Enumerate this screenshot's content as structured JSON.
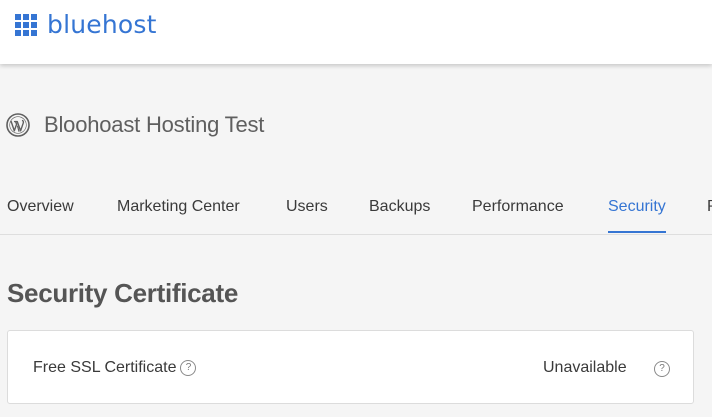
{
  "header": {
    "logo_text": "bluehost",
    "brand_color": "#3575d3"
  },
  "site": {
    "icon": "wordpress-icon",
    "title": "Bloohoast Hosting Test"
  },
  "tabs": [
    {
      "label": "Overview",
      "active": false
    },
    {
      "label": "Marketing Center",
      "active": false
    },
    {
      "label": "Users",
      "active": false
    },
    {
      "label": "Backups",
      "active": false
    },
    {
      "label": "Performance",
      "active": false
    },
    {
      "label": "Security",
      "active": true
    },
    {
      "label": "P",
      "active": false
    }
  ],
  "section": {
    "title": "Security Certificate"
  },
  "ssl": {
    "label": "Free SSL Certificate",
    "help_glyph": "?",
    "status": "Unavailable",
    "status_help_glyph": "?"
  }
}
